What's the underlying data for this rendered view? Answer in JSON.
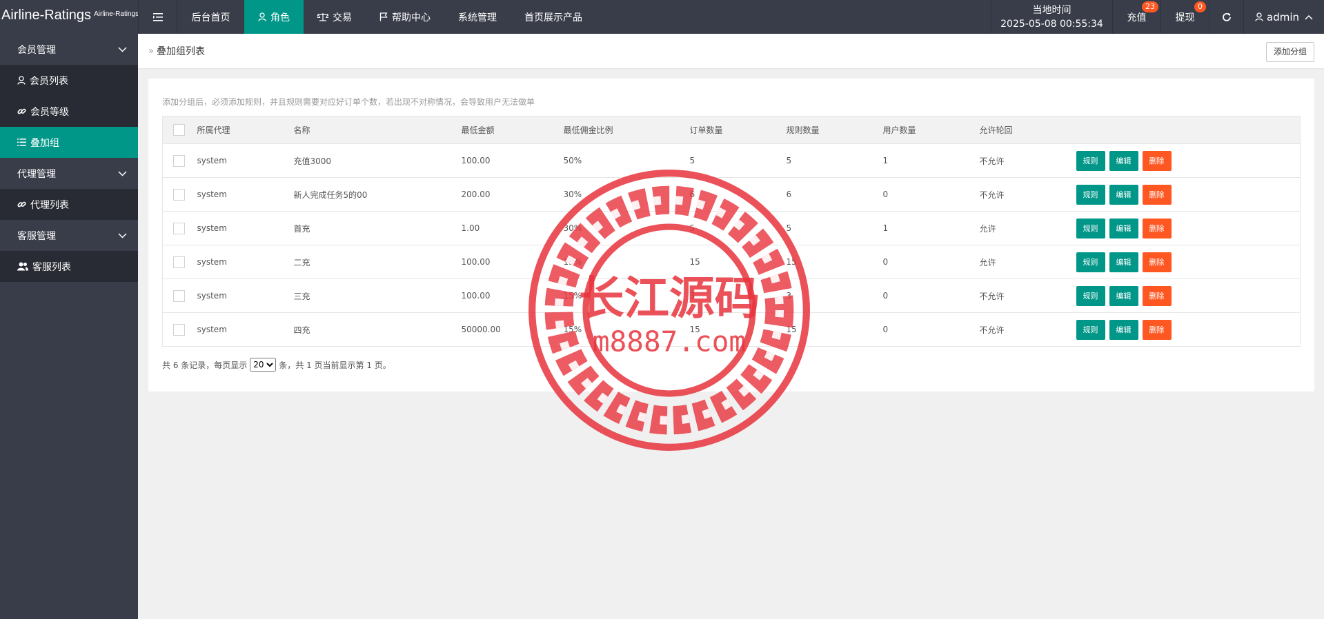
{
  "header": {
    "logo_main": "Airline-Ratings",
    "logo_sub": "Airline-Ratings",
    "nav": [
      {
        "label": "后台首页"
      },
      {
        "label": "角色"
      },
      {
        "label": "交易"
      },
      {
        "label": "帮助中心"
      },
      {
        "label": "系统管理"
      },
      {
        "label": "首页展示产品"
      }
    ],
    "time_label": "当地时间",
    "time_value": "2025-05-08 00:55:34",
    "recharge_label": "充值",
    "recharge_badge": "23",
    "withdraw_label": "提现",
    "withdraw_badge": "0",
    "user": "admin"
  },
  "sidebar": {
    "groups": [
      {
        "label": "会员管理",
        "items": [
          {
            "label": "会员列表"
          },
          {
            "label": "会员等级"
          },
          {
            "label": "叠加组"
          }
        ]
      },
      {
        "label": "代理管理",
        "items": [
          {
            "label": "代理列表"
          }
        ]
      },
      {
        "label": "客服管理",
        "items": [
          {
            "label": "客服列表"
          }
        ]
      }
    ]
  },
  "page": {
    "breadcrumb_sep": "»",
    "title": "叠加组列表",
    "add_button": "添加分组",
    "tip": "添加分组后，必须添加规则，并且规则需要对应好订单个数，若出现不对称情况，会导致用户无法做单"
  },
  "table": {
    "columns": [
      "所属代理",
      "名称",
      "最低金额",
      "最低佣金比例",
      "订单数量",
      "规则数量",
      "用户数量",
      "允许轮回"
    ],
    "rows": [
      {
        "agent": "system",
        "name": "充值3000",
        "min_amount": "100.00",
        "ratio": "50%",
        "orders": "5",
        "rules": "5",
        "users": "1",
        "cycle": "不允许"
      },
      {
        "agent": "system",
        "name": "新人完成任务5的00",
        "min_amount": "200.00",
        "ratio": "30%",
        "orders": "6",
        "rules": "6",
        "users": "0",
        "cycle": "不允许"
      },
      {
        "agent": "system",
        "name": "首充",
        "min_amount": "1.00",
        "ratio": "30%",
        "orders": "5",
        "rules": "5",
        "users": "1",
        "cycle": "允许"
      },
      {
        "agent": "system",
        "name": "二充",
        "min_amount": "100.00",
        "ratio": "15%",
        "orders": "15",
        "rules": "15",
        "users": "0",
        "cycle": "允许"
      },
      {
        "agent": "system",
        "name": "三充",
        "min_amount": "100.00",
        "ratio": "15%",
        "orders": "3",
        "rules": "3",
        "users": "0",
        "cycle": "不允许"
      },
      {
        "agent": "system",
        "name": "四充",
        "min_amount": "50000.00",
        "ratio": "15%",
        "orders": "15",
        "rules": "15",
        "users": "0",
        "cycle": "不允许"
      }
    ],
    "actions": {
      "rule": "规则",
      "edit": "编辑",
      "delete": "删除"
    }
  },
  "pager": {
    "before": "共 6 条记录，每页显示",
    "page_size": "20",
    "after": "条，共 1 页当前显示第 1 页。"
  },
  "watermark": {
    "text": "长江源码",
    "url": "m8887.com"
  },
  "colors": {
    "header_bg": "#393d49",
    "accent": "#009688",
    "danger": "#ff5722",
    "watermark": "#e8323c"
  }
}
